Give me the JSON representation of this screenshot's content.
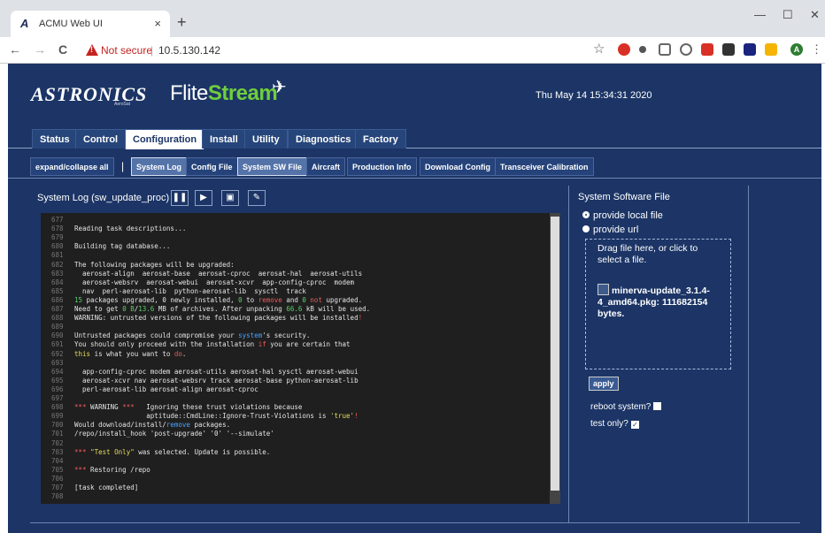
{
  "browser": {
    "tab_title": "ACMU Web UI",
    "tab_close": "×",
    "new_tab": "+",
    "minimize": "—",
    "restore": "☐",
    "close": "✕",
    "back": "←",
    "forward": "→",
    "reload": "C",
    "security_label": "Not secure",
    "separator": "|",
    "url": "10.5.130.142",
    "star": "☆",
    "menu": "⋮",
    "avatar_letter": "A"
  },
  "header": {
    "logo_text": "ASTRONICS",
    "logo_sub": "AeroSat",
    "product_a": "Flite",
    "product_b": "Stream",
    "datetime": "Thu May 14 15:34:31 2020"
  },
  "main_tabs": [
    {
      "label": "Status"
    },
    {
      "label": "Control"
    },
    {
      "label": "Configuration"
    },
    {
      "label": "Install"
    },
    {
      "label": "Utility"
    },
    {
      "label": "Diagnostics"
    },
    {
      "label": "Factory"
    }
  ],
  "sub_tabs": [
    {
      "label": "expand/collapse all"
    },
    {
      "label": "System Log"
    },
    {
      "label": "Config File"
    },
    {
      "label": "System SW File"
    },
    {
      "label": "Aircraft"
    },
    {
      "label": "Production Info"
    },
    {
      "label": "Download Config"
    },
    {
      "label": "Transceiver Calibration"
    }
  ],
  "sub_separator": "|",
  "log": {
    "title": "System Log (sw_update_proc)",
    "controls": {
      "pause": "❚❚",
      "play": "▶",
      "save": "▣",
      "clear": "✎"
    },
    "lines": [
      {
        "n": "677",
        "t": ""
      },
      {
        "n": "678",
        "t": "Reading task descriptions..."
      },
      {
        "n": "679",
        "t": ""
      },
      {
        "n": "680",
        "t": "Building tag database..."
      },
      {
        "n": "681",
        "t": ""
      },
      {
        "n": "682",
        "t": "The following packages will be upgraded:"
      },
      {
        "n": "683",
        "t": "  aerosat-align  aerosat-base  aerosat-cproc  aerosat-hal  aerosat-utils"
      },
      {
        "n": "684",
        "t": "  aerosat-websrv  aerosat-webui  aerosat-xcvr  app-config-cproc  modem"
      },
      {
        "n": "685",
        "t": "  nav  perl-aerosat-lib  python-aerosat-lib  sysctl  track"
      },
      {
        "n": "686",
        "t": "15 packages upgraded, 0 newly installed, 0 to remove and 0 not upgraded."
      },
      {
        "n": "687",
        "t": "Need to get 0 B/13.6 MB of archives. After unpacking 66.6 kB will be used."
      },
      {
        "n": "688",
        "t": "WARNING: untrusted versions of the following packages will be installed!"
      },
      {
        "n": "689",
        "t": ""
      },
      {
        "n": "690",
        "t": "Untrusted packages could compromise your system's security."
      },
      {
        "n": "691",
        "t": "You should only proceed with the installation if you are certain that"
      },
      {
        "n": "692",
        "t": "this is what you want to do."
      },
      {
        "n": "693",
        "t": ""
      },
      {
        "n": "694",
        "t": "  app-config-cproc modem aerosat-utils aerosat-hal sysctl aerosat-webui"
      },
      {
        "n": "695",
        "t": "  aerosat-xcvr nav aerosat-websrv track aerosat-base python-aerosat-lib"
      },
      {
        "n": "696",
        "t": "  perl-aerosat-lib aerosat-align aerosat-cproc"
      },
      {
        "n": "697",
        "t": ""
      },
      {
        "n": "698",
        "t": "*** WARNING ***   Ignoring these trust violations because"
      },
      {
        "n": "699",
        "t": "                  aptitude::CmdLine::Ignore-Trust-Violations is 'true'!"
      },
      {
        "n": "700",
        "t": "Would download/install/remove packages."
      },
      {
        "n": "701",
        "t": "/repo/install_hook 'post-upgrade' '0' '--simulate'"
      },
      {
        "n": "702",
        "t": ""
      },
      {
        "n": "703",
        "t": "*** \"Test Only\" was selected. Update is possible."
      },
      {
        "n": "704",
        "t": ""
      },
      {
        "n": "705",
        "t": "*** Restoring /repo"
      },
      {
        "n": "706",
        "t": ""
      },
      {
        "n": "707",
        "t": "[task completed]"
      },
      {
        "n": "708",
        "t": ""
      }
    ]
  },
  "sw_file": {
    "title": "System Software File",
    "option_local": "provide local file",
    "option_url": "provide url",
    "drop_hint": "Drag file here, or click to select a file.",
    "file_info": "minerva-update_3.1.4-4_amd64.pkg: 111682154 bytes.",
    "apply_label": "apply",
    "reboot_label": "reboot system?",
    "reboot_checked": false,
    "test_label": "test only?",
    "test_checked": true,
    "check_mark": "✓"
  },
  "colors": {
    "app_bg": "#1c3566",
    "accent_green": "#6fce3c",
    "log_bg": "#1f1f1f"
  }
}
